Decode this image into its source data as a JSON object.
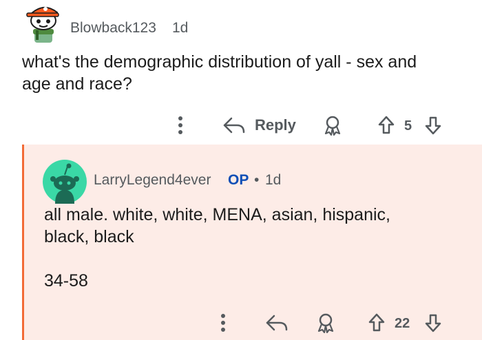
{
  "comments": [
    {
      "username": "Blowback123",
      "age": "1d",
      "body_lines": [
        "what's the demographic distribution of yall - sex and",
        "age and race?"
      ],
      "reply_label": "Reply",
      "votes": "5",
      "avatar_icon": "snoo-avatar-orange-cap"
    },
    {
      "username": "LarryLegend4ever",
      "op_badge": "OP",
      "separator": "•",
      "age": "1d",
      "body_lines": [
        "all male. white, white, MENA, asian, hispanic,",
        "black, black",
        "34-58"
      ],
      "votes": "22",
      "avatar_icon": "default-snoo-avatar"
    }
  ],
  "colors": {
    "thread_line": "#f26b36",
    "highlight_bg": "#fdece7",
    "op_blue": "#0f4fb6",
    "avatar_teal": "#3ad8a6"
  }
}
